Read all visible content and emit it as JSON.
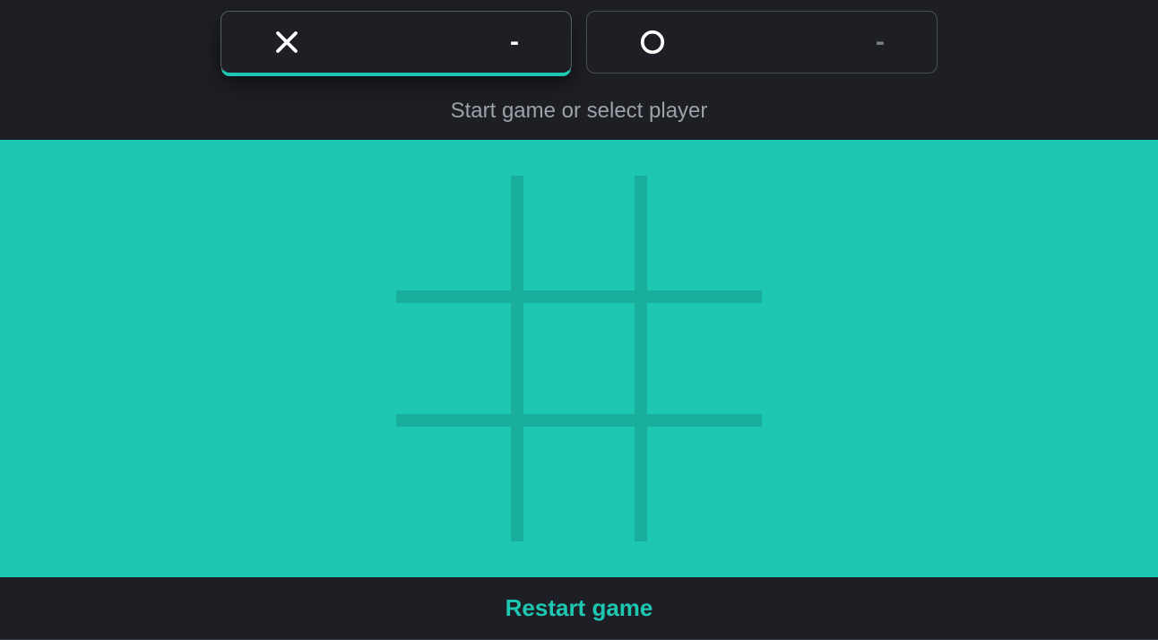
{
  "header": {
    "players": [
      {
        "mark": "X",
        "score": "-",
        "selected": true
      },
      {
        "mark": "O",
        "score": "-",
        "selected": false
      }
    ],
    "status": "Start game or select player"
  },
  "board": {
    "cells": [
      "",
      "",
      "",
      "",
      "",
      "",
      "",
      "",
      ""
    ]
  },
  "footer": {
    "restart_label": "Restart game"
  },
  "colors": {
    "bg_dark": "#1d1f24",
    "accent": "#1ec7b1",
    "grid_line": "#1aae9c",
    "muted_text": "#9ea1a8"
  }
}
